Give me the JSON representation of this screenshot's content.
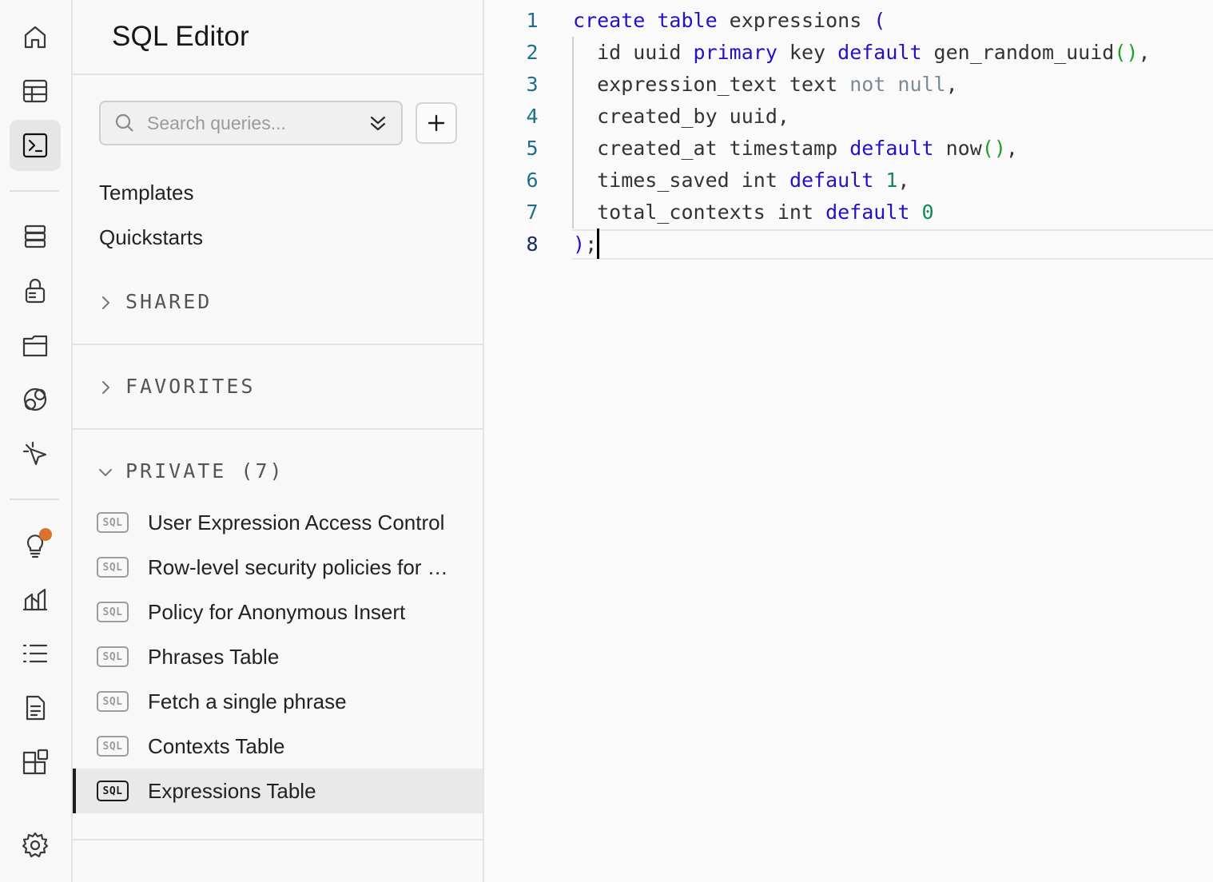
{
  "rail": {
    "items": [
      {
        "name": "home-icon"
      },
      {
        "name": "table-editor-icon"
      },
      {
        "name": "sql-editor-icon",
        "active": true
      },
      {
        "name": "database-icon"
      },
      {
        "name": "auth-icon"
      },
      {
        "name": "storage-icon"
      },
      {
        "name": "realtime-icon"
      },
      {
        "name": "edge-functions-icon"
      },
      {
        "name": "advisors-icon",
        "notification": true
      },
      {
        "name": "reports-icon"
      },
      {
        "name": "logs-icon"
      },
      {
        "name": "api-docs-icon"
      },
      {
        "name": "integrations-icon"
      },
      {
        "name": "settings-icon"
      }
    ]
  },
  "sidebar": {
    "title": "SQL Editor",
    "search": {
      "placeholder": "Search queries..."
    },
    "links": [
      "Templates",
      "Quickstarts"
    ],
    "sections": {
      "shared": "SHARED",
      "favorites": "FAVORITES",
      "private": "PRIVATE (7)"
    },
    "badge": "SQL",
    "queries": [
      {
        "label": "User Expression Access Control",
        "active": false
      },
      {
        "label": "Row-level security policies for …",
        "active": false
      },
      {
        "label": "Policy for Anonymous Insert",
        "active": false
      },
      {
        "label": "Phrases Table",
        "active": false
      },
      {
        "label": "Fetch a single phrase",
        "active": false
      },
      {
        "label": "Contexts Table",
        "active": false
      },
      {
        "label": "Expressions Table",
        "active": true
      }
    ]
  },
  "editor": {
    "active_line": 8,
    "lines": [
      [
        {
          "t": "create table",
          "c": "kw"
        },
        {
          "t": " expressions ",
          "c": ""
        },
        {
          "t": "(",
          "c": "kw"
        }
      ],
      [
        {
          "t": "  id uuid ",
          "c": ""
        },
        {
          "t": "primary",
          "c": "kw"
        },
        {
          "t": " key ",
          "c": ""
        },
        {
          "t": "default",
          "c": "kw"
        },
        {
          "t": " gen_random_uuid",
          "c": ""
        },
        {
          "t": "()",
          "c": "par"
        },
        {
          "t": ",",
          "c": ""
        }
      ],
      [
        {
          "t": "  expression_text text ",
          "c": ""
        },
        {
          "t": "not null",
          "c": "gr"
        },
        {
          "t": ",",
          "c": ""
        }
      ],
      [
        {
          "t": "  created_by uuid,",
          "c": ""
        }
      ],
      [
        {
          "t": "  created_at timestamp ",
          "c": ""
        },
        {
          "t": "default",
          "c": "kw"
        },
        {
          "t": " now",
          "c": ""
        },
        {
          "t": "()",
          "c": "par"
        },
        {
          "t": ",",
          "c": ""
        }
      ],
      [
        {
          "t": "  times_saved int ",
          "c": ""
        },
        {
          "t": "default",
          "c": "kw"
        },
        {
          "t": " ",
          "c": ""
        },
        {
          "t": "1",
          "c": "num"
        },
        {
          "t": ",",
          "c": ""
        }
      ],
      [
        {
          "t": "  total_contexts int ",
          "c": ""
        },
        {
          "t": "default",
          "c": "kw"
        },
        {
          "t": " ",
          "c": ""
        },
        {
          "t": "0",
          "c": "num"
        }
      ],
      [
        {
          "t": ")",
          "c": "kw"
        },
        {
          "t": ";",
          "c": ""
        }
      ]
    ]
  }
}
